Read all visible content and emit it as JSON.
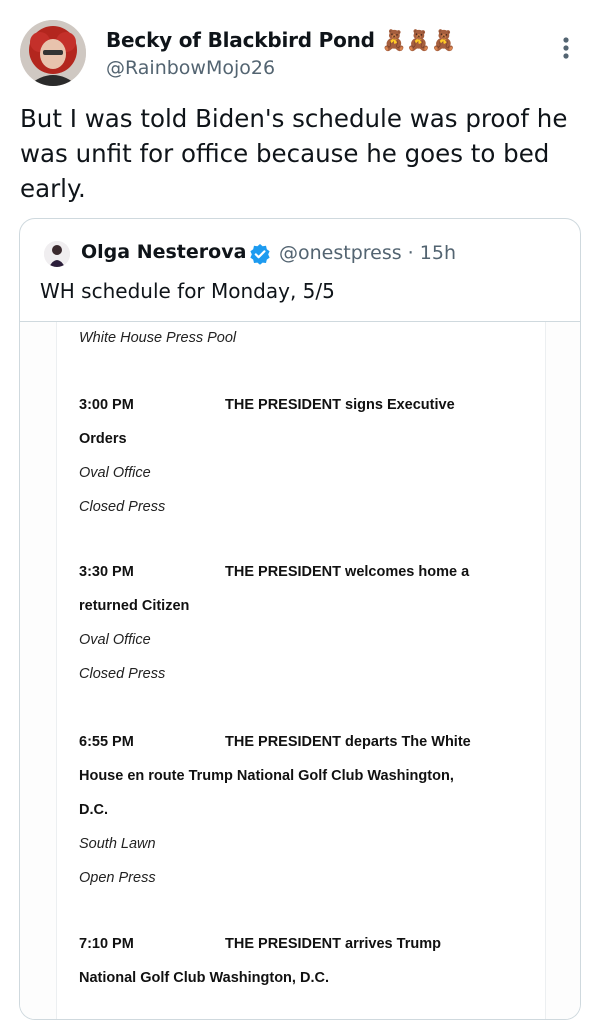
{
  "tweet": {
    "author_name": "Becky of Blackbird Pond 🧸🧸🧸",
    "author_handle": "@RainbowMojo26",
    "text_lines": [
      "But I was told Biden's schedule was proof he",
      "was unfit for office because he goes to bed",
      "early."
    ]
  },
  "quote": {
    "author_name": "Olga Nesterova",
    "author_handle": "@onestpress · 15h",
    "text": "WH schedule for Monday, 5/5"
  },
  "schedule": {
    "top_line": "White House Press Pool",
    "events": [
      {
        "time": "3:00 PM",
        "title_bold": "THE PRESIDENT",
        "title_rest": " signs Executive",
        "continuation": [
          "Orders"
        ],
        "location": "Oval Office",
        "press": "Closed Press"
      },
      {
        "time": "3:30 PM",
        "title_bold": "THE PRESIDENT",
        "title_rest": " welcomes home a",
        "continuation": [
          "returned Citizen"
        ],
        "location": "Oval Office",
        "press": "Closed Press"
      },
      {
        "time": "6:55 PM",
        "title_bold": "THE PRESIDENT",
        "title_rest": " departs The White",
        "continuation": [
          "House en route Trump National Golf Club Washington,",
          "D.C."
        ],
        "location": "South Lawn",
        "press": "Open Press"
      },
      {
        "time": "7:10 PM",
        "title_bold": "THE PRESIDENT",
        "title_rest": " arrives Trump",
        "continuation": [
          "National Golf Club Washington, D.C."
        ],
        "location": "",
        "press": ""
      }
    ]
  },
  "colors": {
    "text": "#0f1419",
    "secondary": "#536471",
    "border": "#cfd9de",
    "verified": "#1d9bf0"
  },
  "icons": {
    "more": "more-vertical-icon",
    "verified": "verified-badge-icon"
  }
}
